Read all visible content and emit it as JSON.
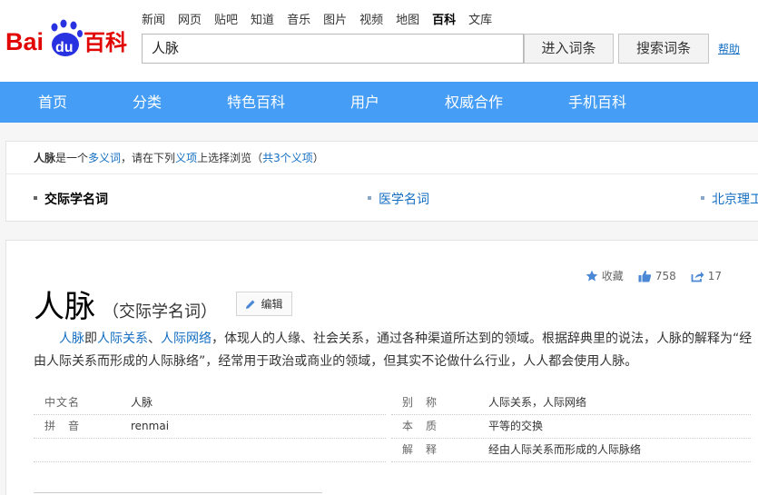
{
  "header": {
    "logo": {
      "text_left": "Bai",
      "text_paw": "du",
      "text_right": "百科",
      "colors": {
        "red": "#e10602",
        "blue": "#2932e1"
      }
    },
    "top_nav": [
      {
        "label": "新闻",
        "active": false
      },
      {
        "label": "网页",
        "active": false
      },
      {
        "label": "贴吧",
        "active": false
      },
      {
        "label": "知道",
        "active": false
      },
      {
        "label": "音乐",
        "active": false
      },
      {
        "label": "图片",
        "active": false
      },
      {
        "label": "视频",
        "active": false
      },
      {
        "label": "地图",
        "active": false
      },
      {
        "label": "百科",
        "active": true
      },
      {
        "label": "文库",
        "active": false
      }
    ],
    "search": {
      "value": "人脉"
    },
    "enter_button": "进入词条",
    "search_button": "搜索词条",
    "help_link": "帮助"
  },
  "main_nav": [
    {
      "label": "首页"
    },
    {
      "label": "分类"
    },
    {
      "label": "特色百科"
    },
    {
      "label": "用户"
    },
    {
      "label": "权威合作"
    },
    {
      "label": "手机百科"
    }
  ],
  "polysemy": {
    "term": "人脉",
    "text1": "是一个",
    "link1": "多义词",
    "text2": "，请在下列",
    "link2": "义项",
    "text3": "上选择浏览（",
    "link3": "共3个义项",
    "text4": "）",
    "senses": [
      {
        "label": "交际学名词",
        "current": true
      },
      {
        "label": "医学名词",
        "current": false
      },
      {
        "label": "北京理工",
        "current": false
      }
    ]
  },
  "entry": {
    "title": "人脉",
    "subtitle": "（交际学名词）",
    "edit_label": "编辑",
    "collect_label": "收藏",
    "like_count": "758",
    "share_count": "17",
    "summary": {
      "term_link": "人脉",
      "t1": "即",
      "link_a": "人际关系",
      "t2": "、",
      "link_b": "人际网络",
      "t3": "，体现人的人缘、社会关系，通过各种渠道所达到的领域。根据辞典里的说法，人脉的解释为“经由人际关系而形成的人际脉络”，经常用于政治或商业的领域，但其实不论做什么行业，人人都会使用人脉。"
    },
    "basic_info": {
      "left": [
        {
          "key": "中文名",
          "value": "人脉"
        },
        {
          "key": "拼　音",
          "value": "renmai"
        },
        {
          "key": "",
          "value": ""
        }
      ],
      "right": [
        {
          "key": "别　称",
          "value": "人际关系，人际网络"
        },
        {
          "key": "本　质",
          "value": "平等的交换"
        },
        {
          "key": "解　释",
          "value": "经由人际关系而形成的人际脉络"
        }
      ]
    }
  },
  "colors": {
    "nav_blue": "#459df5",
    "link": "#136ec2"
  }
}
